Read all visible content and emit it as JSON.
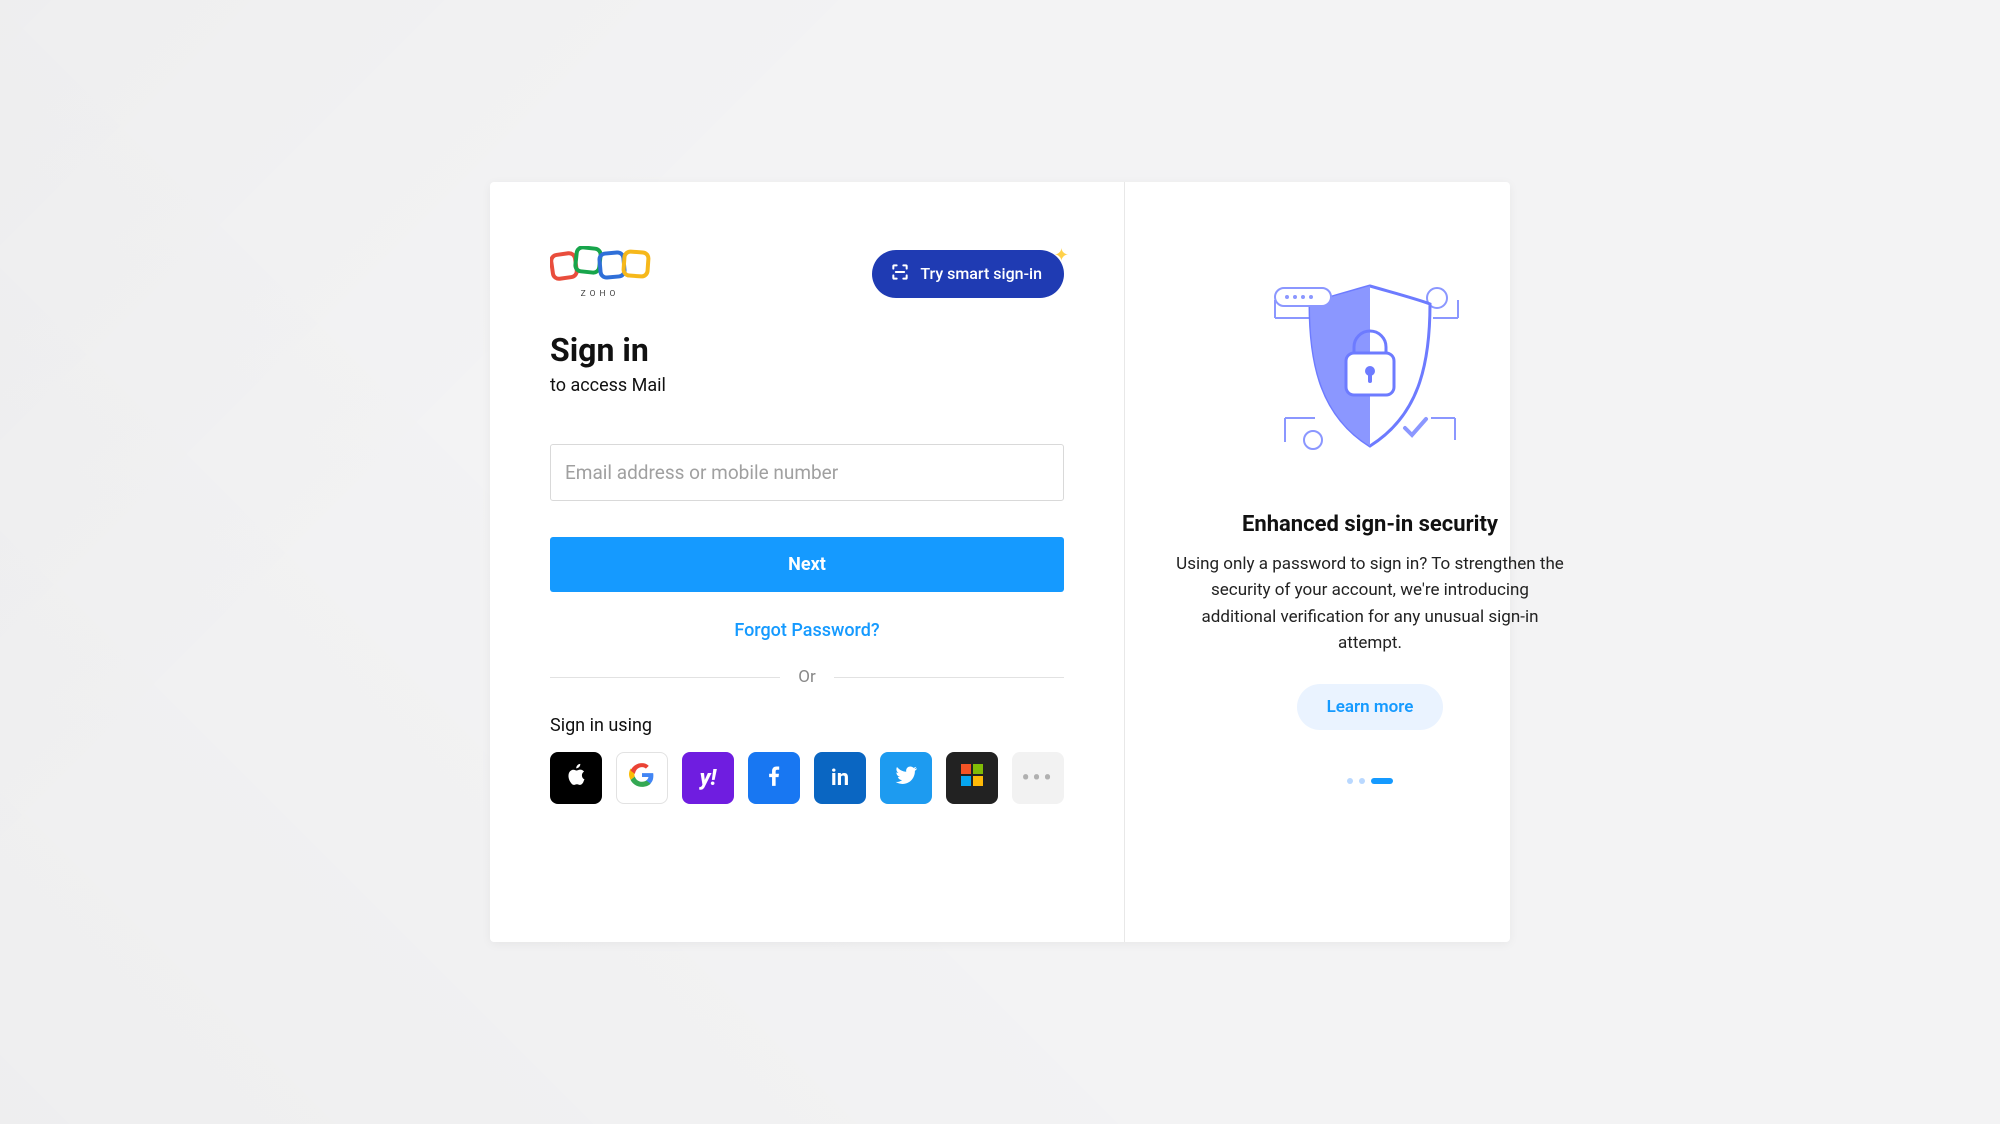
{
  "brand": "ZOHO",
  "smart_signin": {
    "label": "Try smart sign-in"
  },
  "heading": "Sign in",
  "subheading": "to access Mail",
  "email_field": {
    "placeholder": "Email address or mobile number",
    "value": ""
  },
  "next_label": "Next",
  "forgot_label": "Forgot Password?",
  "divider_label": "Or",
  "signin_using_label": "Sign in using",
  "social_providers": [
    "apple",
    "google",
    "yahoo",
    "facebook",
    "linkedin",
    "twitter",
    "microsoft",
    "more"
  ],
  "promo": {
    "title": "Enhanced sign-in security",
    "body": "Using only a password to sign in? To strengthen the security of your account, we're introducing additional verification for any unusual sign-in attempt.",
    "cta": "Learn more",
    "carousel_index": 2,
    "carousel_total": 3
  }
}
